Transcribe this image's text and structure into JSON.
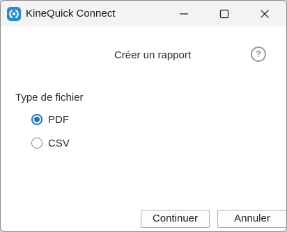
{
  "window": {
    "title": "KineQuick Connect"
  },
  "dialog": {
    "heading": "Créer un rapport",
    "help_label": "?",
    "file_type": {
      "label": "Type de fichier",
      "options": [
        {
          "label": "PDF",
          "selected": true
        },
        {
          "label": "CSV",
          "selected": false
        }
      ]
    },
    "buttons": {
      "continue": "Continuer",
      "cancel": "Annuler"
    }
  },
  "colors": {
    "accent": "#1a73d9",
    "app_icon": "#1f8fd6"
  }
}
